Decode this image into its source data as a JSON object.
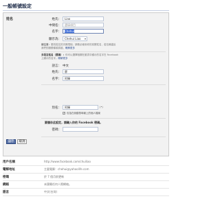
{
  "page_title": "一般帳號設定",
  "name_section": {
    "label": "姓名",
    "last_name_label": "姓氏：",
    "last_name_value": "Liao",
    "middle_name_label": "中間名：",
    "middle_name_placeholder": "選填項目",
    "first_name_label": "名字：",
    "first_name_value": "Chehui",
    "display_as_label": "顯示為：",
    "display_as_value": "Chehui Liao",
    "note_prefix": "請注意：",
    "note_text": "更改姓名的次數限制。請務必使用你的真實姓名，若名稱違反",
    "note_text2": "我們的服務條款將被",
    "note_link": "瞭解更多",
    "alt_language_label": "多語言姓名（選填）：",
    "alt_language_note": "你可以選擇相關在臉書中顯示的名字在 Facebook",
    "alt_language_note2": "上顯示的名字。",
    "alt_language_link": "瞭解更多",
    "language_label": "語言：",
    "language_value": "中文",
    "alt_last_label": "姓氏：",
    "alt_last_value": "廖",
    "alt_first_label": "名字：",
    "alt_first_value": "阿輝",
    "nickname_label": "別名：",
    "nickname_value": "阿輝",
    "nickname_suffix": "(•)",
    "checkbox_label": "包括在我動態時報上的個人檔案",
    "checkbox_mark": "✓",
    "password_prompt": "要儲存此設定，請輸入你的 Facebook 密碼。",
    "password_label": "密碼：",
    "save_label": "儲存",
    "cancel_label": "取消"
  },
  "settings_rows": [
    {
      "key": "用戶名稱",
      "value": "http://www.facebook.com/chuiliao",
      "bold": "chuiliao"
    },
    {
      "key": "電郵地址",
      "value": "主要電郵：chehui@yahoolife.com",
      "bold": ""
    },
    {
      "key": "密碼",
      "value": "於 7 個月前更新",
      "bold": ""
    },
    {
      "key": "網絡",
      "value": "未隸屬任何人際網絡。",
      "bold": ""
    },
    {
      "key": "語言",
      "value": "中文(台灣)",
      "bold": ""
    }
  ]
}
